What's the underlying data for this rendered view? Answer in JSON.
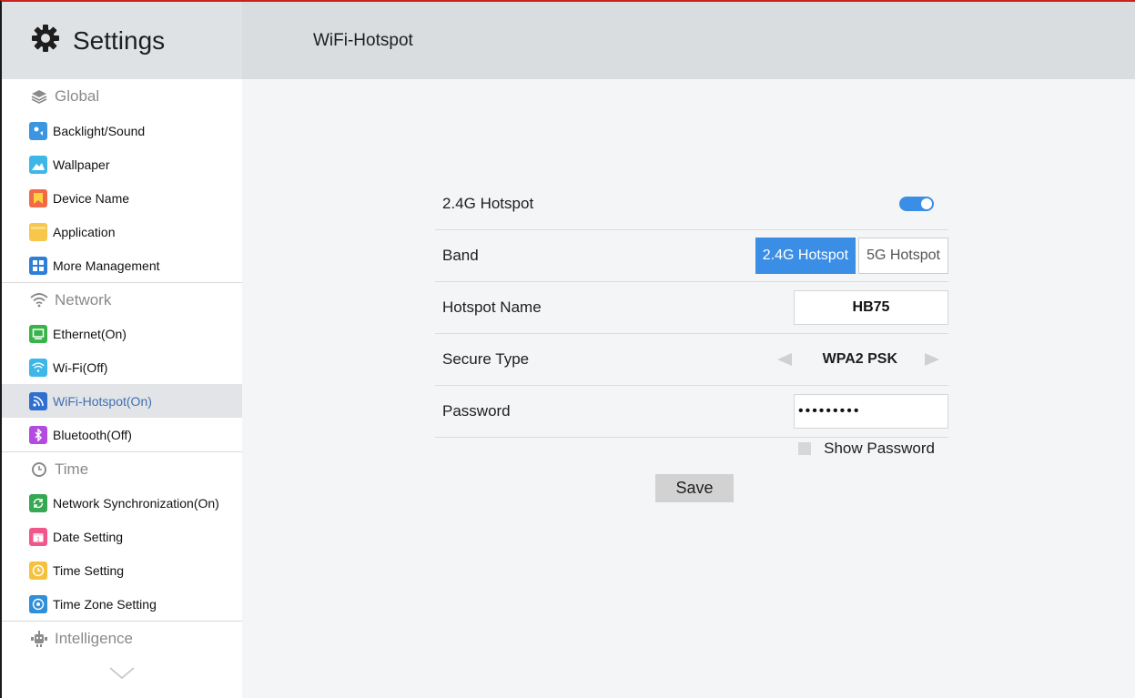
{
  "sidebar": {
    "title": "Settings",
    "sections": {
      "global": "Global",
      "network": "Network",
      "time": "Time",
      "intelligence": "Intelligence"
    },
    "items": {
      "backlight": "Backlight/Sound",
      "wallpaper": "Wallpaper",
      "device_name": "Device Name",
      "application": "Application",
      "more_management": "More Management",
      "ethernet": "Ethernet(On)",
      "wifi": "Wi-Fi(Off)",
      "hotspot": "WiFi-Hotspot(On)",
      "bluetooth": "Bluetooth(Off)",
      "network_sync": "Network Synchronization(On)",
      "date_setting": "Date Setting",
      "time_setting": "Time Setting",
      "time_zone": "Time Zone Setting"
    }
  },
  "header": {
    "title": "WiFi-Hotspot"
  },
  "form": {
    "hotspot_label": "2.4G Hotspot",
    "hotspot_enabled": true,
    "band_label": "Band",
    "band_options": [
      "2.4G Hotspot",
      "5G Hotspot"
    ],
    "band_selected": "2.4G Hotspot",
    "name_label": "Hotspot Name",
    "name_value": "HB75",
    "secure_label": "Secure Type",
    "secure_value": "WPA2 PSK",
    "password_label": "Password",
    "password_value": "•••••••••",
    "show_password_label": "Show Password",
    "show_password_checked": false,
    "save_label": "Save"
  },
  "colors": {
    "accent": "#3a8ee6",
    "active_text": "#3f6fb2",
    "header_bg": "#dadde0",
    "content_bg": "#f4f5f6"
  }
}
